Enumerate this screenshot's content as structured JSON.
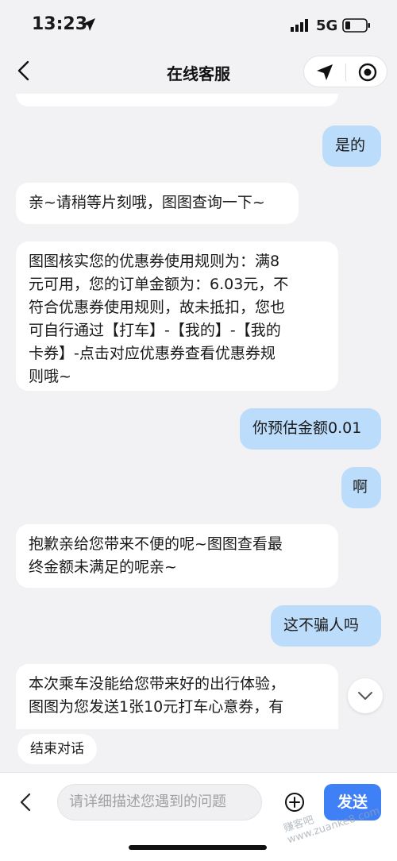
{
  "status": {
    "time": "13:23",
    "network": "5G"
  },
  "nav": {
    "title": "在线客服"
  },
  "messages": [
    {
      "side": "left",
      "text": ""
    },
    {
      "side": "right",
      "text": "是的"
    },
    {
      "side": "left",
      "text": "亲~请稍等片刻哦，图图查询一下~"
    },
    {
      "side": "left",
      "text": "图图核实您的优惠券使用规则为：满8\n元可用，您的订单金额为：6.03元，不\n符合优惠券使用规则，故未抵扣，您也\n可自行通过【打车】-【我的】-【我的\n卡券】-点击对应优惠券查看优惠券规\n则哦~"
    },
    {
      "side": "right",
      "text": "你预估金额0.01"
    },
    {
      "side": "right",
      "text": "啊"
    },
    {
      "side": "left",
      "text": "抱歉亲给您带来不便的呢~图图查看最\n终金额未满足的呢亲~"
    },
    {
      "side": "right",
      "text": "这不骗人吗"
    },
    {
      "side": "left",
      "text": "本次乘车没能给您带来好的出行体验，\n图图为您发送1张10元打车心意券，有"
    }
  ],
  "end_chat_label": "结束对话",
  "input": {
    "placeholder": "请详细描述您遇到的问题"
  },
  "send_label": "发送",
  "watermark": "赚客吧 www.zuanke8.com",
  "colors": {
    "send": "#3f80f7",
    "right_bubble": "#bcdcfb",
    "background": "#f2f2f5"
  },
  "icons": [
    "location-arrow-icon",
    "signal-icon",
    "battery-icon",
    "back-chevron-icon",
    "navigate-icon",
    "target-circle-icon",
    "chevron-down-icon",
    "plus-circle-icon"
  ]
}
